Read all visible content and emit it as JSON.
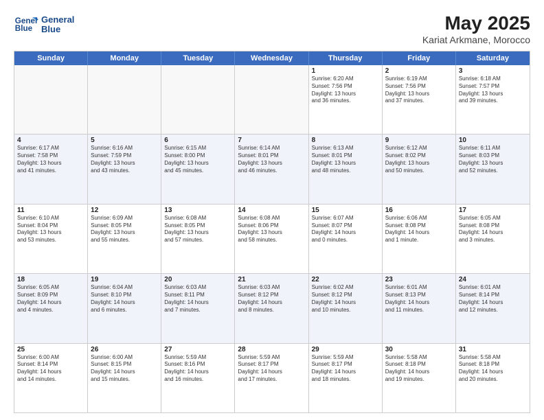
{
  "header": {
    "logo_line1": "General",
    "logo_line2": "Blue",
    "title": "May 2025",
    "subtitle": "Kariat Arkmane, Morocco"
  },
  "weekdays": [
    "Sunday",
    "Monday",
    "Tuesday",
    "Wednesday",
    "Thursday",
    "Friday",
    "Saturday"
  ],
  "rows": [
    [
      {
        "day": "",
        "text": "",
        "empty": true
      },
      {
        "day": "",
        "text": "",
        "empty": true
      },
      {
        "day": "",
        "text": "",
        "empty": true
      },
      {
        "day": "",
        "text": "",
        "empty": true
      },
      {
        "day": "1",
        "text": "Sunrise: 6:20 AM\nSunset: 7:56 PM\nDaylight: 13 hours\nand 36 minutes."
      },
      {
        "day": "2",
        "text": "Sunrise: 6:19 AM\nSunset: 7:56 PM\nDaylight: 13 hours\nand 37 minutes."
      },
      {
        "day": "3",
        "text": "Sunrise: 6:18 AM\nSunset: 7:57 PM\nDaylight: 13 hours\nand 39 minutes."
      }
    ],
    [
      {
        "day": "4",
        "text": "Sunrise: 6:17 AM\nSunset: 7:58 PM\nDaylight: 13 hours\nand 41 minutes."
      },
      {
        "day": "5",
        "text": "Sunrise: 6:16 AM\nSunset: 7:59 PM\nDaylight: 13 hours\nand 43 minutes."
      },
      {
        "day": "6",
        "text": "Sunrise: 6:15 AM\nSunset: 8:00 PM\nDaylight: 13 hours\nand 45 minutes."
      },
      {
        "day": "7",
        "text": "Sunrise: 6:14 AM\nSunset: 8:01 PM\nDaylight: 13 hours\nand 46 minutes."
      },
      {
        "day": "8",
        "text": "Sunrise: 6:13 AM\nSunset: 8:01 PM\nDaylight: 13 hours\nand 48 minutes."
      },
      {
        "day": "9",
        "text": "Sunrise: 6:12 AM\nSunset: 8:02 PM\nDaylight: 13 hours\nand 50 minutes."
      },
      {
        "day": "10",
        "text": "Sunrise: 6:11 AM\nSunset: 8:03 PM\nDaylight: 13 hours\nand 52 minutes."
      }
    ],
    [
      {
        "day": "11",
        "text": "Sunrise: 6:10 AM\nSunset: 8:04 PM\nDaylight: 13 hours\nand 53 minutes."
      },
      {
        "day": "12",
        "text": "Sunrise: 6:09 AM\nSunset: 8:05 PM\nDaylight: 13 hours\nand 55 minutes."
      },
      {
        "day": "13",
        "text": "Sunrise: 6:08 AM\nSunset: 8:05 PM\nDaylight: 13 hours\nand 57 minutes."
      },
      {
        "day": "14",
        "text": "Sunrise: 6:08 AM\nSunset: 8:06 PM\nDaylight: 13 hours\nand 58 minutes."
      },
      {
        "day": "15",
        "text": "Sunrise: 6:07 AM\nSunset: 8:07 PM\nDaylight: 14 hours\nand 0 minutes."
      },
      {
        "day": "16",
        "text": "Sunrise: 6:06 AM\nSunset: 8:08 PM\nDaylight: 14 hours\nand 1 minute."
      },
      {
        "day": "17",
        "text": "Sunrise: 6:05 AM\nSunset: 8:08 PM\nDaylight: 14 hours\nand 3 minutes."
      }
    ],
    [
      {
        "day": "18",
        "text": "Sunrise: 6:05 AM\nSunset: 8:09 PM\nDaylight: 14 hours\nand 4 minutes."
      },
      {
        "day": "19",
        "text": "Sunrise: 6:04 AM\nSunset: 8:10 PM\nDaylight: 14 hours\nand 6 minutes."
      },
      {
        "day": "20",
        "text": "Sunrise: 6:03 AM\nSunset: 8:11 PM\nDaylight: 14 hours\nand 7 minutes."
      },
      {
        "day": "21",
        "text": "Sunrise: 6:03 AM\nSunset: 8:12 PM\nDaylight: 14 hours\nand 8 minutes."
      },
      {
        "day": "22",
        "text": "Sunrise: 6:02 AM\nSunset: 8:12 PM\nDaylight: 14 hours\nand 10 minutes."
      },
      {
        "day": "23",
        "text": "Sunrise: 6:01 AM\nSunset: 8:13 PM\nDaylight: 14 hours\nand 11 minutes."
      },
      {
        "day": "24",
        "text": "Sunrise: 6:01 AM\nSunset: 8:14 PM\nDaylight: 14 hours\nand 12 minutes."
      }
    ],
    [
      {
        "day": "25",
        "text": "Sunrise: 6:00 AM\nSunset: 8:14 PM\nDaylight: 14 hours\nand 14 minutes."
      },
      {
        "day": "26",
        "text": "Sunrise: 6:00 AM\nSunset: 8:15 PM\nDaylight: 14 hours\nand 15 minutes."
      },
      {
        "day": "27",
        "text": "Sunrise: 5:59 AM\nSunset: 8:16 PM\nDaylight: 14 hours\nand 16 minutes."
      },
      {
        "day": "28",
        "text": "Sunrise: 5:59 AM\nSunset: 8:17 PM\nDaylight: 14 hours\nand 17 minutes."
      },
      {
        "day": "29",
        "text": "Sunrise: 5:59 AM\nSunset: 8:17 PM\nDaylight: 14 hours\nand 18 minutes."
      },
      {
        "day": "30",
        "text": "Sunrise: 5:58 AM\nSunset: 8:18 PM\nDaylight: 14 hours\nand 19 minutes."
      },
      {
        "day": "31",
        "text": "Sunrise: 5:58 AM\nSunset: 8:18 PM\nDaylight: 14 hours\nand 20 minutes."
      }
    ]
  ]
}
